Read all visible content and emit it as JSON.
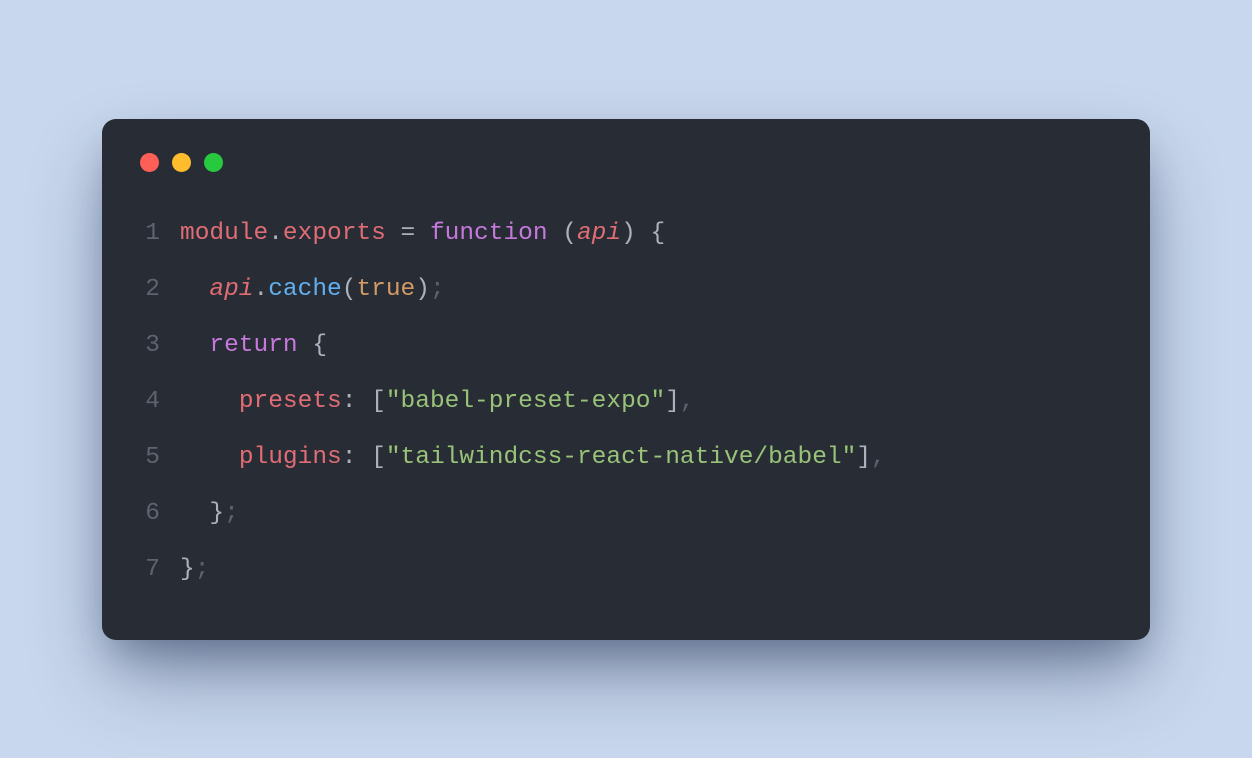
{
  "traffic_lights": [
    "red",
    "yellow",
    "green"
  ],
  "code": {
    "lines": [
      {
        "n": "1",
        "tokens": [
          {
            "cls": "t-var",
            "t": "module"
          },
          {
            "cls": "t-punct",
            "t": "."
          },
          {
            "cls": "t-prop",
            "t": "exports"
          },
          {
            "cls": "t-punct",
            "t": " "
          },
          {
            "cls": "t-punct",
            "t": "="
          },
          {
            "cls": "t-punct",
            "t": " "
          },
          {
            "cls": "t-keyword",
            "t": "function"
          },
          {
            "cls": "t-punct",
            "t": " "
          },
          {
            "cls": "t-punct",
            "t": "("
          },
          {
            "cls": "t-param",
            "t": "api"
          },
          {
            "cls": "t-punct",
            "t": ")"
          },
          {
            "cls": "t-punct",
            "t": " "
          },
          {
            "cls": "t-punct",
            "t": "{"
          }
        ]
      },
      {
        "n": "2",
        "tokens": [
          {
            "cls": "t-base",
            "t": "  "
          },
          {
            "cls": "t-param",
            "t": "api"
          },
          {
            "cls": "t-punct",
            "t": "."
          },
          {
            "cls": "t-method",
            "t": "cache"
          },
          {
            "cls": "t-punct",
            "t": "("
          },
          {
            "cls": "t-bool",
            "t": "true"
          },
          {
            "cls": "t-punct",
            "t": ")"
          },
          {
            "cls": "t-punct-dim",
            "t": ";"
          }
        ]
      },
      {
        "n": "3",
        "tokens": [
          {
            "cls": "t-base",
            "t": "  "
          },
          {
            "cls": "t-keyword",
            "t": "return"
          },
          {
            "cls": "t-punct",
            "t": " "
          },
          {
            "cls": "t-punct",
            "t": "{"
          }
        ]
      },
      {
        "n": "4",
        "tokens": [
          {
            "cls": "t-base",
            "t": "    "
          },
          {
            "cls": "t-key",
            "t": "presets"
          },
          {
            "cls": "t-punct",
            "t": ":"
          },
          {
            "cls": "t-punct",
            "t": " "
          },
          {
            "cls": "t-punct",
            "t": "["
          },
          {
            "cls": "t-string",
            "t": "\"babel-preset-expo\""
          },
          {
            "cls": "t-punct",
            "t": "]"
          },
          {
            "cls": "t-punct-dim",
            "t": ","
          }
        ]
      },
      {
        "n": "5",
        "tokens": [
          {
            "cls": "t-base",
            "t": "    "
          },
          {
            "cls": "t-key",
            "t": "plugins"
          },
          {
            "cls": "t-punct",
            "t": ":"
          },
          {
            "cls": "t-punct",
            "t": " "
          },
          {
            "cls": "t-punct",
            "t": "["
          },
          {
            "cls": "t-string",
            "t": "\"tailwindcss-react-native/babel\""
          },
          {
            "cls": "t-punct",
            "t": "]"
          },
          {
            "cls": "t-punct-dim",
            "t": ","
          }
        ]
      },
      {
        "n": "6",
        "tokens": [
          {
            "cls": "t-base",
            "t": "  "
          },
          {
            "cls": "t-punct",
            "t": "}"
          },
          {
            "cls": "t-punct-dim",
            "t": ";"
          }
        ]
      },
      {
        "n": "7",
        "tokens": [
          {
            "cls": "t-punct",
            "t": "}"
          },
          {
            "cls": "t-punct-dim",
            "t": ";"
          }
        ]
      }
    ]
  }
}
